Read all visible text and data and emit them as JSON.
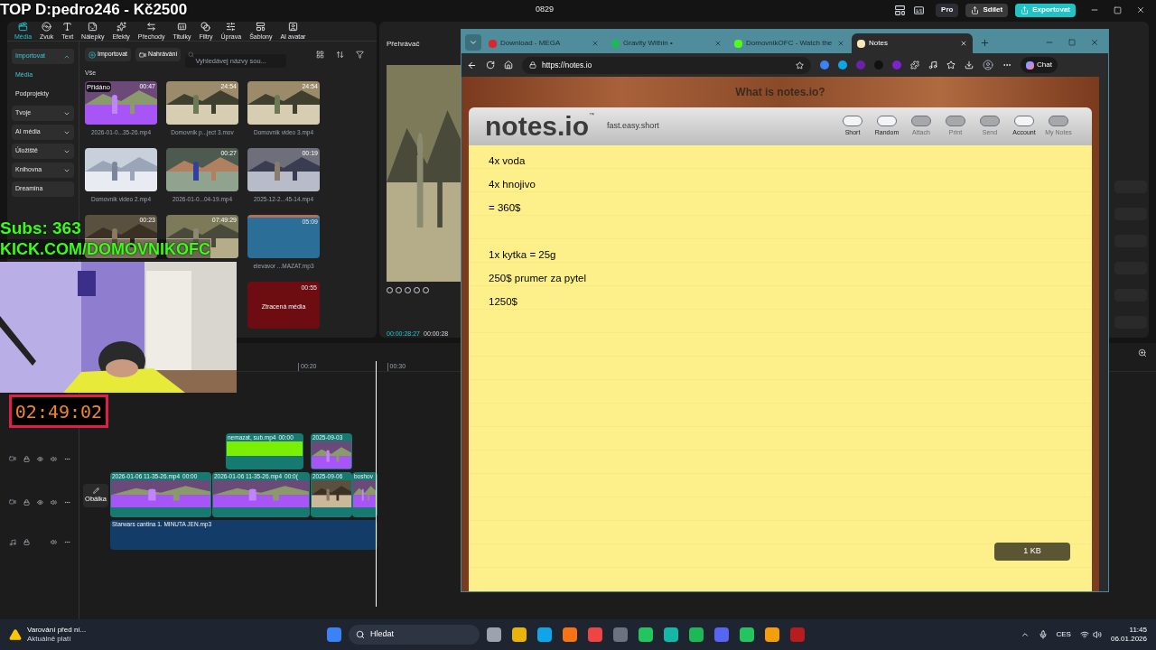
{
  "overlay": {
    "top_text": "TOP D:pedro246 - Kč2500",
    "subs": "Subs: 363",
    "channel": "KICK.COM/DOMOVNIKOFC",
    "timer": "02:49:02"
  },
  "editor": {
    "title": "0829",
    "pro": "Pro",
    "share": "Sdílet",
    "export": "Exportovat"
  },
  "toolbar": [
    {
      "label": "Média",
      "selected": true
    },
    {
      "label": "Zvuk",
      "selected": false
    },
    {
      "label": "Text",
      "selected": false
    },
    {
      "label": "Nálepky",
      "selected": false
    },
    {
      "label": "Efekty",
      "selected": false
    },
    {
      "label": "Přechody",
      "selected": false
    },
    {
      "label": "Titulky",
      "selected": false
    },
    {
      "label": "Filtry",
      "selected": false
    },
    {
      "label": "Úprava",
      "selected": false
    },
    {
      "label": "Šablony",
      "selected": false
    },
    {
      "label": "AI avatar",
      "selected": false
    }
  ],
  "sidebar": [
    {
      "label": "Importovat",
      "kind": "folder",
      "expanded": true
    },
    {
      "label": "Média",
      "kind": "link",
      "selected": true
    },
    {
      "label": "Podprojekty",
      "kind": "link",
      "selected": false
    },
    {
      "label": "Tvoje",
      "kind": "folder",
      "expanded": false
    },
    {
      "label": "AI média",
      "kind": "folder",
      "expanded": false
    },
    {
      "label": "Úložiště",
      "kind": "folder",
      "expanded": false
    },
    {
      "label": "Knihovna",
      "kind": "folder",
      "expanded": false
    },
    {
      "label": "Dreamina",
      "kind": "plain"
    }
  ],
  "media_actions": {
    "import": "Importovat",
    "record": "Nahrávání",
    "search_placeholder": "Vyhledávej názvy sou..."
  },
  "media_filter": "Vše",
  "media": [
    {
      "kind": "video",
      "name": "2026-01-0...35-26.mp4",
      "duration": "00:47",
      "badge": "Přidáno"
    },
    {
      "kind": "video",
      "name": "Domovnik p...ject 3.mov",
      "duration": "24:54"
    },
    {
      "kind": "video",
      "name": "Domovnik video 3.mp4",
      "duration": "24:54"
    },
    {
      "kind": "video",
      "name": "Domovnik video 2.mp4"
    },
    {
      "kind": "video",
      "name": "2026-01-0...04-19.mp4",
      "duration": "00:27"
    },
    {
      "kind": "video",
      "name": "2025-12-2...45-14.mp4",
      "duration": "00:19"
    },
    {
      "kind": "video",
      "duration": "00:23"
    },
    {
      "kind": "video",
      "duration": "07:49:29"
    },
    {
      "kind": "audio",
      "name": "elevavor ...MAZAT.mp3",
      "duration": "05:09"
    },
    {
      "kind": "missing",
      "label": "Ztracená média",
      "duration": "00:55"
    }
  ],
  "player": {
    "title": "Přehrávač",
    "time_current": "00:00:28:27",
    "time_total": "00:00:28"
  },
  "timeline": {
    "ticks": [
      "00:20",
      "00:30"
    ],
    "cover": "Obálka",
    "tracks": [
      {
        "kind": "overlay",
        "clips": [
          {
            "name": "nemazat, sub.mp4",
            "time": "00:00",
            "kind": "green"
          },
          {
            "name": "2025-09-03",
            "kind": "video"
          }
        ]
      },
      {
        "kind": "main",
        "clips": [
          {
            "name": "2026-01-06 11-35-26.mp4",
            "time": "00:00",
            "kind": "video"
          },
          {
            "name": "2026-01-06 11-35-26.mp4",
            "time": "00:0(",
            "kind": "video"
          },
          {
            "name": "2025-09-06",
            "kind": "video"
          },
          {
            "name": "boshov",
            "kind": "video"
          }
        ]
      },
      {
        "kind": "audio",
        "clips": [
          {
            "name": "Starwars cantina 1. MINUTA JEN.mp3",
            "kind": "audio"
          }
        ]
      }
    ]
  },
  "browser": {
    "tabs": [
      {
        "title": "Download - MEGA",
        "selected": false
      },
      {
        "title": "Gravity Within •",
        "selected": false
      },
      {
        "title": "DomovnikOFC - Watch the",
        "selected": false
      },
      {
        "title": "Notes",
        "selected": true
      }
    ],
    "url": "https://notes.io",
    "chat": "Chat"
  },
  "notes": {
    "banner": "What is notes.io?",
    "logo": "notes.io",
    "tm": "™",
    "tagline": "fast.easy.short",
    "tools": [
      {
        "label": "Short",
        "disabled": false
      },
      {
        "label": "Random",
        "disabled": false
      },
      {
        "label": "Attach",
        "disabled": true
      },
      {
        "label": "Print",
        "disabled": true
      },
      {
        "label": "Send",
        "disabled": true
      },
      {
        "label": "Account",
        "disabled": false
      },
      {
        "label": "My Notes",
        "disabled": true
      }
    ],
    "lines": [
      {
        "text": "4x voda",
        "gap_before": false
      },
      {
        "text": "4x hnojivo",
        "gap_before": false
      },
      {
        "text": "= 360$",
        "gap_before": false
      },
      {
        "text": "1x kytka = 25g",
        "gap_before": true
      },
      {
        "text": "250$ prumer za pytel",
        "gap_before": false
      },
      {
        "text": "1250$",
        "gap_before": false
      }
    ],
    "size": "1 KB"
  },
  "taskbar": {
    "alert_title": "Varování před ní...",
    "alert_sub": "Aktuálně platí",
    "search": "Hledat",
    "lang": "CES",
    "time": "11:45",
    "date": "06.01.2026"
  }
}
